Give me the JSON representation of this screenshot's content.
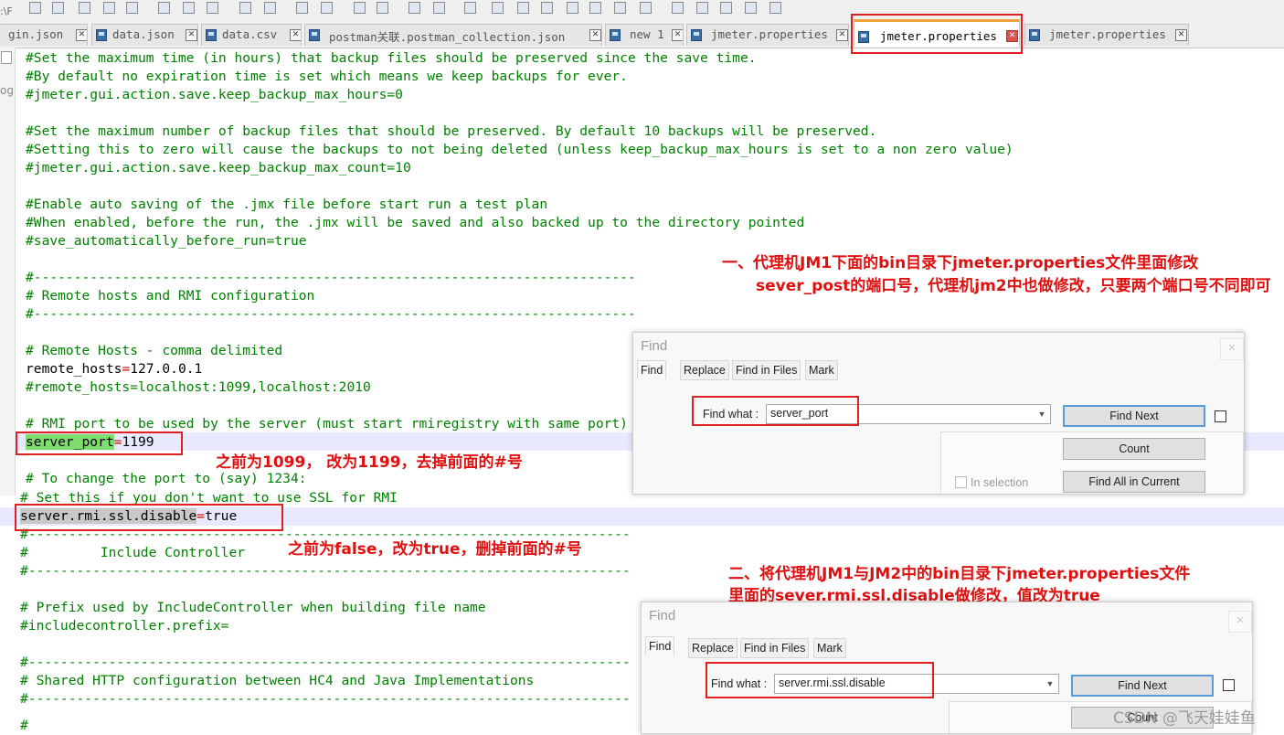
{
  "tabs": [
    {
      "label": "gin.json"
    },
    {
      "label": "data.json"
    },
    {
      "label": "data.csv"
    },
    {
      "label": "postman关联.postman_collection.json"
    },
    {
      "label": "new 1"
    },
    {
      "label": "jmeter.properties"
    },
    {
      "label": "jmeter.properties"
    },
    {
      "label": "jmeter.properties"
    }
  ],
  "left_strip": {
    "path_fragment": ":\\F",
    "og_fragment": "og"
  },
  "editor_top": {
    "lines": [
      "#Set the maximum time (in hours) that backup files should be preserved since the save time.",
      "#By default no expiration time is set which means we keep backups for ever.",
      "#jmeter.gui.action.save.keep_backup_max_hours=0",
      "",
      "#Set the maximum number of backup files that should be preserved. By default 10 backups will be preserved.",
      "#Setting this to zero will cause the backups to not being deleted (unless keep_backup_max_hours is set to a non zero value)",
      "#jmeter.gui.action.save.keep_backup_max_count=10",
      "",
      "#Enable auto saving of the .jmx file before start run a test plan",
      "#When enabled, before the run, the .jmx will be saved and also backed up to the directory pointed",
      "#save_automatically_before_run=true",
      "",
      "#---------------------------------------------------------------------------",
      "# Remote hosts and RMI configuration",
      "#---------------------------------------------------------------------------",
      "",
      "# Remote Hosts - comma delimited",
      "",
      "#remote_hosts=localhost:1099,localhost:2010",
      "",
      "# RMI port to be used by the server (must start rmiregistry with same port)",
      "",
      "",
      "# To change the port to (say) 1234:"
    ],
    "remote_hosts": {
      "key": "remote_hosts",
      "op": "=",
      "value": "127.0.0.1"
    },
    "server_port": {
      "key": "server_port",
      "op": "=",
      "value": "1199"
    }
  },
  "editor_bottom": {
    "lines": [
      "# Set this if you don't want to use SSL for RMI",
      "",
      "#---------------------------------------------------------------------------",
      "#         Include Controller",
      "#---------------------------------------------------------------------------",
      "",
      "# Prefix used by IncludeController when building file name",
      "#includecontroller.prefix=",
      "",
      "#---------------------------------------------------------------------------",
      "# Shared HTTP configuration between HC4 and Java Implementations",
      "#---------------------------------------------------------------------------",
      "",
      "#"
    ],
    "ssl_disable": {
      "key": "server.rmi.ssl.disable",
      "op": "=",
      "value": "true"
    }
  },
  "annotations": {
    "a1_line1": "一、代理机JM1下面的bin目录下jmeter.properties文件里面修改",
    "a1_line2": "sever_post的端口号，代理机jm2中也做修改，只要两个端口号不同即可",
    "a2": "之前为1099， 改为1199，去掉前面的#号",
    "a3": "之前为false，改为true，删掉前面的#号",
    "a4_line1": "二、将代理机JM1与JM2中的bin目录下jmeter.properties文件",
    "a4_line2": "里面的sever.rmi.ssl.disable做修改，值改为true"
  },
  "find1": {
    "title": "Find",
    "close": "✕",
    "tabs": [
      "Find",
      "Replace",
      "Find in Files",
      "Mark"
    ],
    "find_what_label": "Find what :",
    "find_what_value": "server_port",
    "find_next": "Find Next",
    "count": "Count",
    "in_selection": "In selection",
    "find_all": "Find All in Current"
  },
  "find2": {
    "title": "Find",
    "close": "✕",
    "tabs": [
      "Find",
      "Replace",
      "Find in Files",
      "Mark"
    ],
    "find_what_label": "Find what :",
    "find_what_value": "server.rmi.ssl.disable",
    "find_next": "Find Next",
    "count": "Count"
  },
  "watermark": "CSDN @飞天娃娃鱼",
  "colors": {
    "comment": "#008000",
    "operator": "#d00000",
    "annotation": "#e01010",
    "active_tab_accent": "#f2a33a",
    "search_highlight": "#7fdc6e"
  }
}
